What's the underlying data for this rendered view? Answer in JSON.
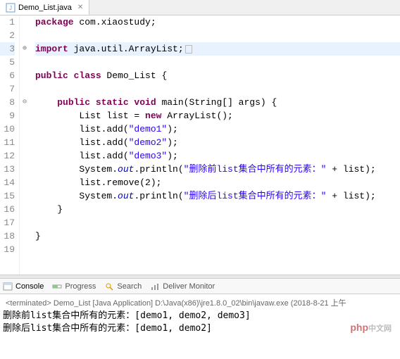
{
  "tab": {
    "filename": "Demo_List.java"
  },
  "code": {
    "lines": [
      {
        "n": 1,
        "segs": [
          [
            "kw",
            "package"
          ],
          [
            "",
            " com.xiaostudy;"
          ]
        ]
      },
      {
        "n": 2,
        "segs": [
          [
            "",
            ""
          ]
        ]
      },
      {
        "n": 3,
        "hl": true,
        "fold": "⊕",
        "segs": [
          [
            "kw",
            "import"
          ],
          [
            "",
            " java.util.ArrayList;"
          ]
        ],
        "marker": true
      },
      {
        "n": 5,
        "segs": [
          [
            "",
            ""
          ]
        ]
      },
      {
        "n": 6,
        "segs": [
          [
            "kw",
            "public class"
          ],
          [
            "",
            " Demo_List {"
          ]
        ]
      },
      {
        "n": 7,
        "segs": [
          [
            "",
            ""
          ]
        ]
      },
      {
        "n": 8,
        "fold": "⊖",
        "segs": [
          [
            "",
            "    "
          ],
          [
            "kw",
            "public static void"
          ],
          [
            "",
            " main(String[] args) {"
          ]
        ]
      },
      {
        "n": 9,
        "segs": [
          [
            "",
            "        List list = "
          ],
          [
            "kw",
            "new"
          ],
          [
            "",
            " ArrayList();"
          ]
        ]
      },
      {
        "n": 10,
        "segs": [
          [
            "",
            "        list.add("
          ],
          [
            "str",
            "\"demo1\""
          ],
          [
            "",
            ");"
          ]
        ]
      },
      {
        "n": 11,
        "segs": [
          [
            "",
            "        list.add("
          ],
          [
            "str",
            "\"demo2\""
          ],
          [
            "",
            ");"
          ]
        ]
      },
      {
        "n": 12,
        "segs": [
          [
            "",
            "        list.add("
          ],
          [
            "str",
            "\"demo3\""
          ],
          [
            "",
            ");"
          ]
        ]
      },
      {
        "n": 13,
        "segs": [
          [
            "",
            "        System."
          ],
          [
            "field",
            "out"
          ],
          [
            "",
            ".println("
          ],
          [
            "str",
            "\"删除前list集合中所有的元素：\""
          ],
          [
            "",
            " + list);"
          ]
        ]
      },
      {
        "n": 14,
        "segs": [
          [
            "",
            "        list.remove(2);"
          ]
        ]
      },
      {
        "n": 15,
        "segs": [
          [
            "",
            "        System."
          ],
          [
            "field",
            "out"
          ],
          [
            "",
            ".println("
          ],
          [
            "str",
            "\"删除后list集合中所有的元素：\""
          ],
          [
            "",
            " + list);"
          ]
        ]
      },
      {
        "n": 16,
        "segs": [
          [
            "",
            "    }"
          ]
        ]
      },
      {
        "n": 17,
        "segs": [
          [
            "",
            ""
          ]
        ]
      },
      {
        "n": 18,
        "segs": [
          [
            "",
            "}"
          ]
        ]
      },
      {
        "n": 19,
        "segs": [
          [
            "",
            ""
          ]
        ]
      }
    ]
  },
  "console": {
    "tabs": [
      "Console",
      "Progress",
      "Search",
      "Deliver Monitor"
    ],
    "status": "<terminated> Demo_List [Java Application] D:\\Java(x86)\\jre1.8.0_02\\bin\\javaw.exe (2018-8-21 上午",
    "output": [
      "删除前list集合中所有的元素：[demo1, demo2, demo3]",
      "删除后list集合中所有的元素：[demo1, demo2]"
    ]
  },
  "watermark": {
    "main": "php",
    "sub": "中文网"
  }
}
